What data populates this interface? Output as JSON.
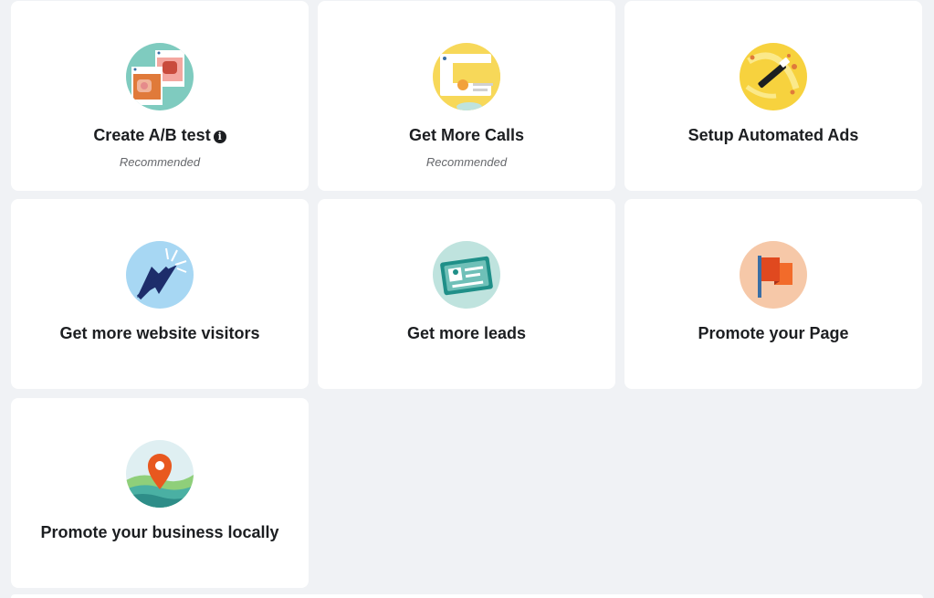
{
  "cards": [
    {
      "title": "Create A/B test",
      "info_icon": "i",
      "subtitle": "Recommended",
      "icon": "ab-test-icon"
    },
    {
      "title": "Get More Calls",
      "subtitle": "Recommended",
      "icon": "phone-call-icon"
    },
    {
      "title": "Setup Automated Ads",
      "icon": "magic-wand-icon"
    },
    {
      "title": "Get more website visitors",
      "icon": "cursor-click-icon"
    },
    {
      "title": "Get more leads",
      "icon": "id-card-icon"
    },
    {
      "title": "Promote your Page",
      "icon": "flag-icon"
    },
    {
      "title": "Promote your business locally",
      "icon": "location-pin-icon"
    }
  ],
  "colors": {
    "background": "#f0f2f5",
    "card": "#ffffff",
    "text": "#1c1e21",
    "subtext": "#65676b"
  }
}
